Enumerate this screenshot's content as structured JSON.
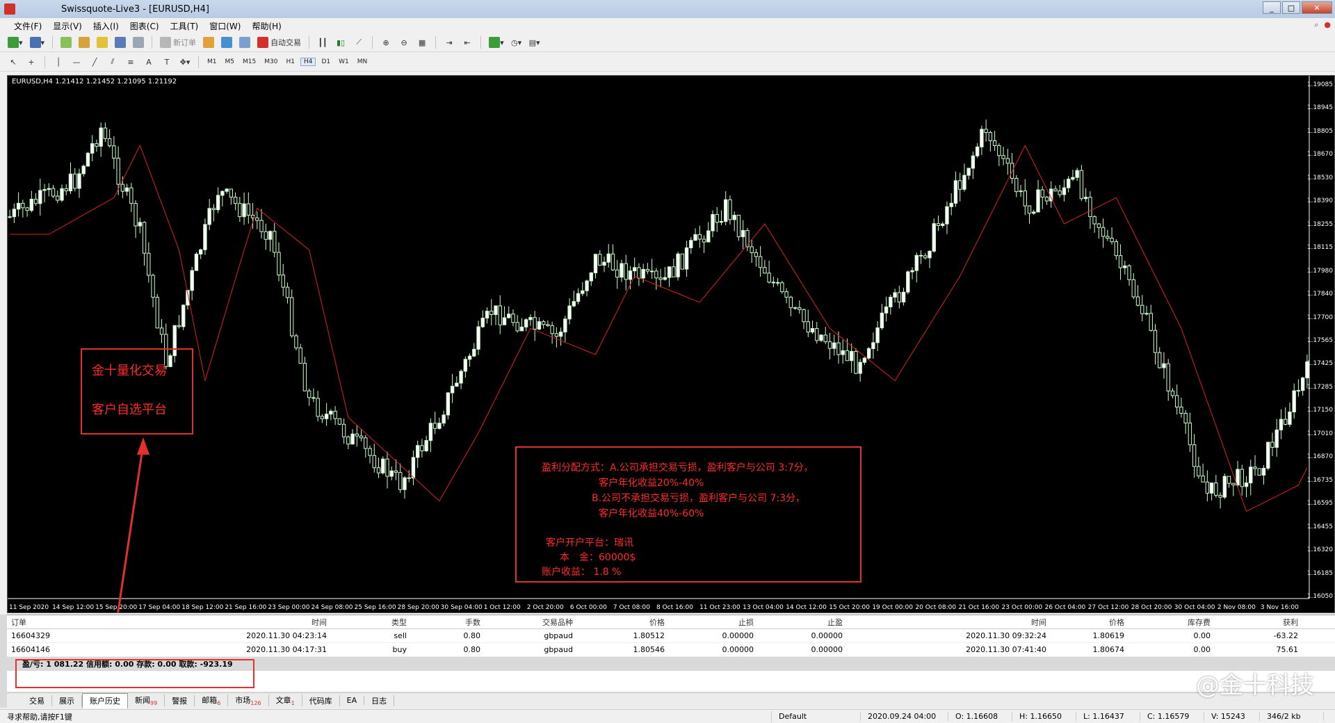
{
  "window": {
    "title": "Swissquote-Live3 - [EURUSD,H4]"
  },
  "menu": [
    "文件(F)",
    "显示(V)",
    "插入(I)",
    "图表(C)",
    "工具(T)",
    "窗口(W)",
    "帮助(H)"
  ],
  "toolbar": {
    "new_order": "新订单",
    "auto_trade": "自动交易"
  },
  "timeframes": [
    "M1",
    "M5",
    "M15",
    "M30",
    "H1",
    "H4",
    "D1",
    "W1",
    "MN"
  ],
  "active_timeframe": "H4",
  "chart": {
    "header": "EURUSD,H4  1.21412 1.21452 1.21095 1.21192",
    "price_ticks": [
      "1.19085",
      "1.18945",
      "1.18805",
      "1.18670",
      "1.18530",
      "1.18390",
      "1.18255",
      "1.18115",
      "1.17980",
      "1.17840",
      "1.17700",
      "1.17565",
      "1.17425",
      "1.17285",
      "1.17150",
      "1.17010",
      "1.16870",
      "1.16735",
      "1.16595",
      "1.16455",
      "1.16320",
      "1.16185",
      "1.16050"
    ],
    "time_ticks": [
      "11 Sep 2020",
      "14 Sep 12:00",
      "15 Sep 20:00",
      "17 Sep 04:00",
      "18 Sep 12:00",
      "21 Sep 16:00",
      "23 Sep 00:00",
      "24 Sep 08:00",
      "25 Sep 16:00",
      "28 Sep 20:00",
      "30 Sep 04:00",
      "1 Oct 12:00",
      "2 Oct 20:00",
      "6 Oct 00:00",
      "7 Oct 08:00",
      "8 Oct 16:00",
      "11 Oct 23:00",
      "13 Oct 04:00",
      "14 Oct 12:00",
      "15 Oct 20:00",
      "19 Oct 00:00",
      "20 Oct 08:00",
      "21 Oct 16:00",
      "23 Oct 00:00",
      "26 Oct 04:00",
      "27 Oct 12:00",
      "28 Oct 20:00",
      "30 Oct 04:00",
      "2 Nov 08:00",
      "3 Nov 16:00"
    ],
    "colors": {
      "bg": "#000000",
      "bull": "#ccffcc",
      "bear": "#ccffcc",
      "ma": "#d9231f"
    }
  },
  "annotation_left": {
    "line1": "金十量化交易",
    "line2": "客户自选平台"
  },
  "annotation_right": {
    "line1": "盈利分配方式：A.公司承担交易亏损，盈利客户与公司 3:7分，",
    "line2": "客户年化收益20%-40%",
    "line3": "B.公司不承担交易亏损，盈利客户与公司 7:3分，",
    "line4": "客户年化收益40%-60%",
    "line5": "客户开户平台：瑞讯",
    "line6": "本　金：60000$",
    "line7": "账户收益：  1.8  %"
  },
  "orders": {
    "headers": [
      "订单",
      "时间",
      "类型",
      "手数",
      "交易品种",
      "价格",
      "止损",
      "止盈",
      "时间",
      "价格",
      "库存费",
      "获利"
    ],
    "rows": [
      [
        "16604329",
        "2020.11.30 04:23:14",
        "sell",
        "0.80",
        "gbpaud",
        "1.80512",
        "0.00000",
        "0.00000",
        "2020.11.30 09:32:24",
        "1.80619",
        "0.00",
        "-63.22"
      ],
      [
        "16604146",
        "2020.11.30 04:17:31",
        "buy",
        "0.80",
        "gbpaud",
        "1.80546",
        "0.00000",
        "0.00000",
        "2020.11.30 07:41:40",
        "1.80674",
        "0.00",
        "75.61"
      ]
    ],
    "summary": "盈/亏: 1 081.22  信用额: 0.00  存款: 0.00  取款: -923.19"
  },
  "tabs": [
    {
      "label": "交易",
      "badge": ""
    },
    {
      "label": "展示",
      "badge": ""
    },
    {
      "label": "账户历史",
      "badge": ""
    },
    {
      "label": "新闻",
      "badge": "99"
    },
    {
      "label": "警报",
      "badge": ""
    },
    {
      "label": "邮箱",
      "badge": "6"
    },
    {
      "label": "市场",
      "badge": "126"
    },
    {
      "label": "文章",
      "badge": "1"
    },
    {
      "label": "代码库",
      "badge": ""
    },
    {
      "label": "EA",
      "badge": ""
    },
    {
      "label": "日志",
      "badge": ""
    }
  ],
  "active_tab": "账户历史",
  "status": {
    "help": "寻求帮助,请按F1键",
    "profile": "Default",
    "datetime": "2020.09.24 04:00",
    "open": "O: 1.16608",
    "high": "H: 1.16650",
    "low": "L: 1.16437",
    "close": "C: 1.16579",
    "volume": "V: 15243",
    "traffic": "346/2 kb"
  },
  "watermark": "@金十科技"
}
